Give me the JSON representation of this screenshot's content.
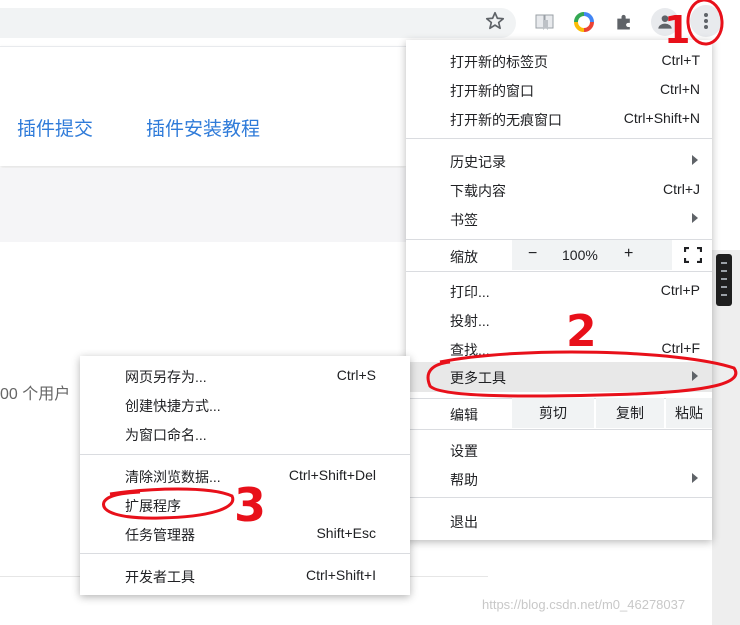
{
  "toolbar": {
    "icons": [
      "star-icon",
      "reading-list-icon",
      "color-extension-icon",
      "puzzle-extension-icon",
      "profile-icon",
      "more-vert-icon"
    ]
  },
  "page": {
    "links": [
      "插件提交",
      "插件安装教程"
    ],
    "users_text": "00 个用户",
    "watermark": "https://blog.csdn.net/m0_46278037"
  },
  "menu": {
    "items": [
      {
        "label": "打开新的标签页",
        "shortcut": "Ctrl+T"
      },
      {
        "label": "打开新的窗口",
        "shortcut": "Ctrl+N"
      },
      {
        "label": "打开新的无痕窗口",
        "shortcut": "Ctrl+Shift+N"
      },
      {
        "label": "历史记录",
        "shortcut": ""
      },
      {
        "label": "下载内容",
        "shortcut": "Ctrl+J"
      },
      {
        "label": "书签",
        "shortcut": ""
      },
      {
        "label": "打印...",
        "shortcut": "Ctrl+P"
      },
      {
        "label": "投射...",
        "shortcut": ""
      },
      {
        "label": "查找...",
        "shortcut": "Ctrl+F"
      },
      {
        "label": "更多工具",
        "shortcut": ""
      },
      {
        "label": "设置",
        "shortcut": ""
      },
      {
        "label": "帮助",
        "shortcut": ""
      },
      {
        "label": "退出",
        "shortcut": ""
      }
    ],
    "zoom": {
      "label": "缩放",
      "minus": "−",
      "value": "100%",
      "plus": "+"
    },
    "edit": {
      "label": "编辑",
      "cut": "剪切",
      "copy": "复制",
      "paste": "粘贴"
    }
  },
  "submenu": {
    "items": [
      {
        "label": "网页另存为...",
        "shortcut": "Ctrl+S"
      },
      {
        "label": "创建快捷方式...",
        "shortcut": ""
      },
      {
        "label": "为窗口命名...",
        "shortcut": ""
      },
      {
        "label": "清除浏览数据...",
        "shortcut": "Ctrl+Shift+Del"
      },
      {
        "label": "扩展程序",
        "shortcut": ""
      },
      {
        "label": "任务管理器",
        "shortcut": "Shift+Esc"
      },
      {
        "label": "开发者工具",
        "shortcut": "Ctrl+Shift+I"
      }
    ]
  },
  "annotations": {
    "numbers": [
      "1",
      "2",
      "3"
    ],
    "color": "#e8101a"
  },
  "colors": {
    "link": "#2f7bd9",
    "menu_bg": "#ffffff",
    "highlight": "#e8e8e8"
  }
}
